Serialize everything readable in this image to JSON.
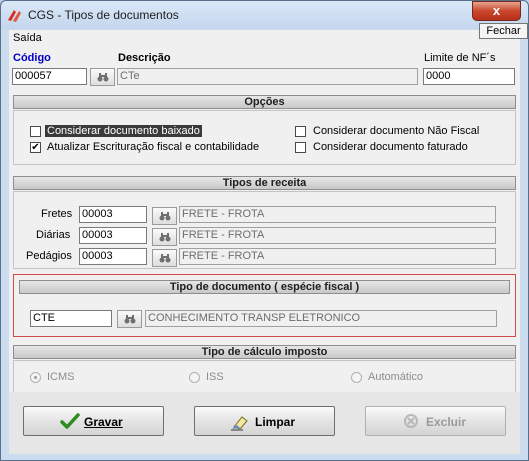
{
  "window": {
    "title": "CGS - Tipos de documentos",
    "close_glyph": "x",
    "tooltip": "Fechar"
  },
  "menu": {
    "saida": "Saída"
  },
  "header": {
    "codigo_label": "Código",
    "codigo_value": "000057",
    "descricao_label": "Descrição",
    "descricao_value": "CTe",
    "limite_label": "Limite de NF´s",
    "limite_value": "0000"
  },
  "opcoes": {
    "title": "Opções",
    "options": [
      {
        "label": "Considerar documento baixado",
        "checked": false
      },
      {
        "label": "Atualizar Escrituração fiscal e contabilidade",
        "checked": true
      },
      {
        "label": "Considerar documento Não Fiscal",
        "checked": false
      },
      {
        "label": "Considerar documento faturado",
        "checked": false
      }
    ]
  },
  "tipos_receita": {
    "title": "Tipos de receita",
    "rows": [
      {
        "label": "Fretes",
        "code": "00003",
        "desc": "FRETE - FROTA"
      },
      {
        "label": "Diárias",
        "code": "00003",
        "desc": "FRETE - FROTA"
      },
      {
        "label": "Pedágios",
        "code": "00003",
        "desc": "FRETE - FROTA"
      }
    ]
  },
  "tipo_documento": {
    "title": "Tipo de documento ( espécie fiscal )",
    "code": "CTE",
    "desc": "CONHECIMENTO TRANSP ELETRONICO"
  },
  "tipo_calculo": {
    "title": "Tipo de cálculo imposto",
    "options": [
      {
        "label": "ICMS",
        "selected": true
      },
      {
        "label": "ISS",
        "selected": false
      },
      {
        "label": "Automático",
        "selected": false
      }
    ]
  },
  "buttons": {
    "gravar": "Gravar",
    "limpar": "Limpar",
    "excluir": "Excluir"
  },
  "icons": {
    "app": "app-logo-icon",
    "search": "binoculars-icon",
    "gravar": "checkmark-icon",
    "limpar": "eraser-icon",
    "excluir": "delete-icon"
  }
}
